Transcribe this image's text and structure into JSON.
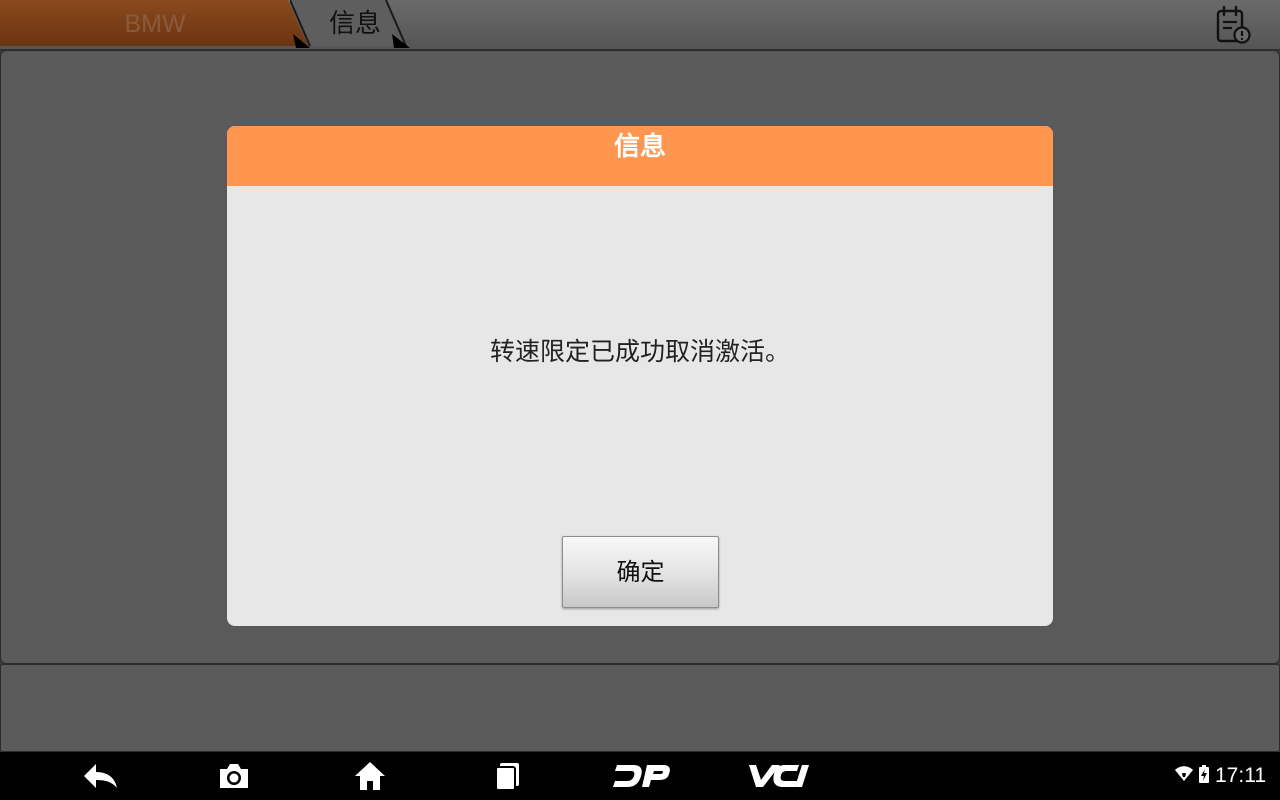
{
  "breadcrumb": {
    "brand": "BMW",
    "current": "信息"
  },
  "header_icons": {
    "report": "report-clipboard-icon"
  },
  "dialog": {
    "title": "信息",
    "message": "转速限定已成功取消激活。",
    "ok_label": "确定"
  },
  "navbar": {
    "buttons": [
      "back-icon",
      "camera-icon",
      "home-icon",
      "recent-apps-icon",
      "dp-icon",
      "vci-icon"
    ],
    "dp_label": "DP",
    "vci_label": "VCI"
  },
  "status": {
    "time": "17:11",
    "icons": [
      "wifi-icon",
      "battery-charging-icon"
    ]
  },
  "colors": {
    "dialog_header": "#ff9650",
    "panel": "#5a5a5b",
    "brand_tab": "#7a3f16"
  }
}
